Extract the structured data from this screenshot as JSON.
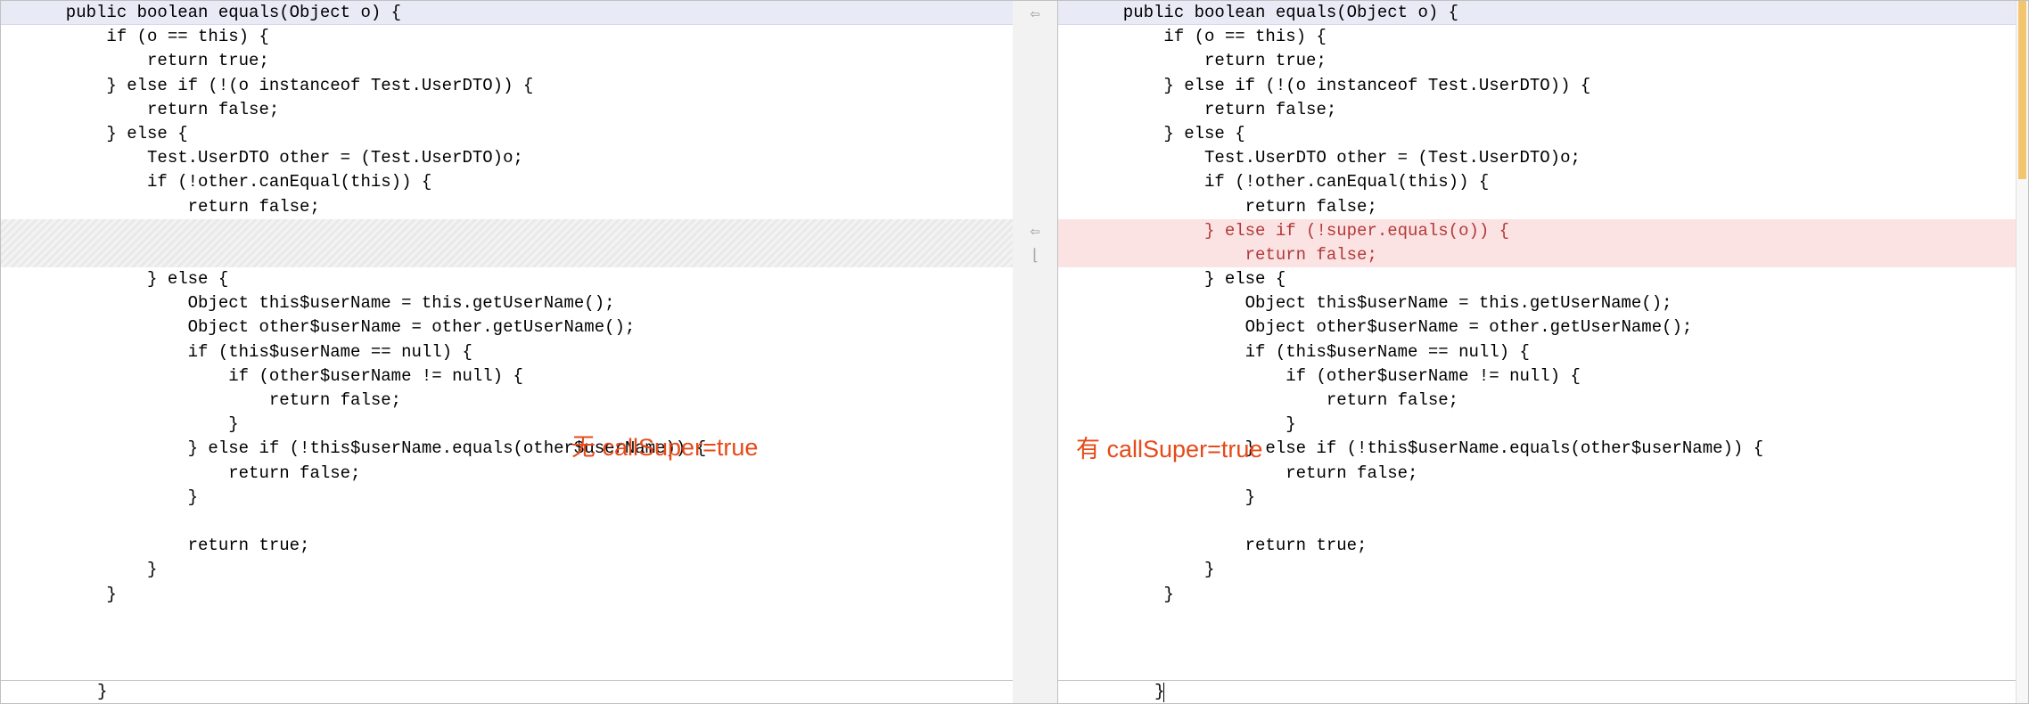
{
  "left": {
    "lines": [
      {
        "text": "  public boolean equals(Object o) {",
        "cls": "first-line"
      },
      {
        "text": "      if (o == this) {"
      },
      {
        "text": "          return true;"
      },
      {
        "text": "      } else if (!(o instanceof Test.UserDTO)) {"
      },
      {
        "text": "          return false;"
      },
      {
        "text": "      } else {"
      },
      {
        "text": "          Test.UserDTO other = (Test.UserDTO)o;"
      },
      {
        "text": "          if (!other.canEqual(this)) {"
      },
      {
        "text": "              return false;"
      },
      {
        "text": "",
        "cls": "diff-gap"
      },
      {
        "text": "          } else {"
      },
      {
        "text": "              Object this$userName = this.getUserName();"
      },
      {
        "text": "              Object other$userName = other.getUserName();"
      },
      {
        "text": "              if (this$userName == null) {"
      },
      {
        "text": "                  if (other$userName != null) {"
      },
      {
        "text": "                      return false;"
      },
      {
        "text": "                  }"
      },
      {
        "text": "              } else if (!this$userName.equals(other$userName)) {"
      },
      {
        "text": "                  return false;"
      },
      {
        "text": "              }"
      },
      {
        "text": ""
      },
      {
        "text": "              return true;"
      },
      {
        "text": "          }"
      },
      {
        "text": "      }"
      }
    ],
    "bottom": "  }",
    "annotation": "无 callSuper=true"
  },
  "right": {
    "lines": [
      {
        "text": "  public boolean equals(Object o) {",
        "cls": "first-line"
      },
      {
        "text": "      if (o == this) {"
      },
      {
        "text": "          return true;"
      },
      {
        "text": "      } else if (!(o instanceof Test.UserDTO)) {"
      },
      {
        "text": "          return false;"
      },
      {
        "text": "      } else {"
      },
      {
        "text": "          Test.UserDTO other = (Test.UserDTO)o;"
      },
      {
        "text": "          if (!other.canEqual(this)) {"
      },
      {
        "text": "              return false;"
      },
      {
        "text": "          } else if (!super.equals(o)) {",
        "cls": "diff-added"
      },
      {
        "text": "              return false;",
        "cls": "diff-added"
      },
      {
        "text": "          } else {"
      },
      {
        "text": "              Object this$userName = this.getUserName();"
      },
      {
        "text": "              Object other$userName = other.getUserName();"
      },
      {
        "text": "              if (this$userName == null) {"
      },
      {
        "text": "                  if (other$userName != null) {"
      },
      {
        "text": "                      return false;"
      },
      {
        "text": "                  }"
      },
      {
        "text": "              } else if (!this$userName.equals(other$userName)) {"
      },
      {
        "text": "                  return false;"
      },
      {
        "text": "              }"
      },
      {
        "text": ""
      },
      {
        "text": "              return true;"
      },
      {
        "text": "          }"
      },
      {
        "text": "      }"
      }
    ],
    "bottom": "  }",
    "annotation": "有 callSuper=true"
  },
  "gutter": {
    "marker_top": "⇦",
    "marker_mid_arrow": "⇦",
    "marker_mid_bracket": "⌊"
  }
}
